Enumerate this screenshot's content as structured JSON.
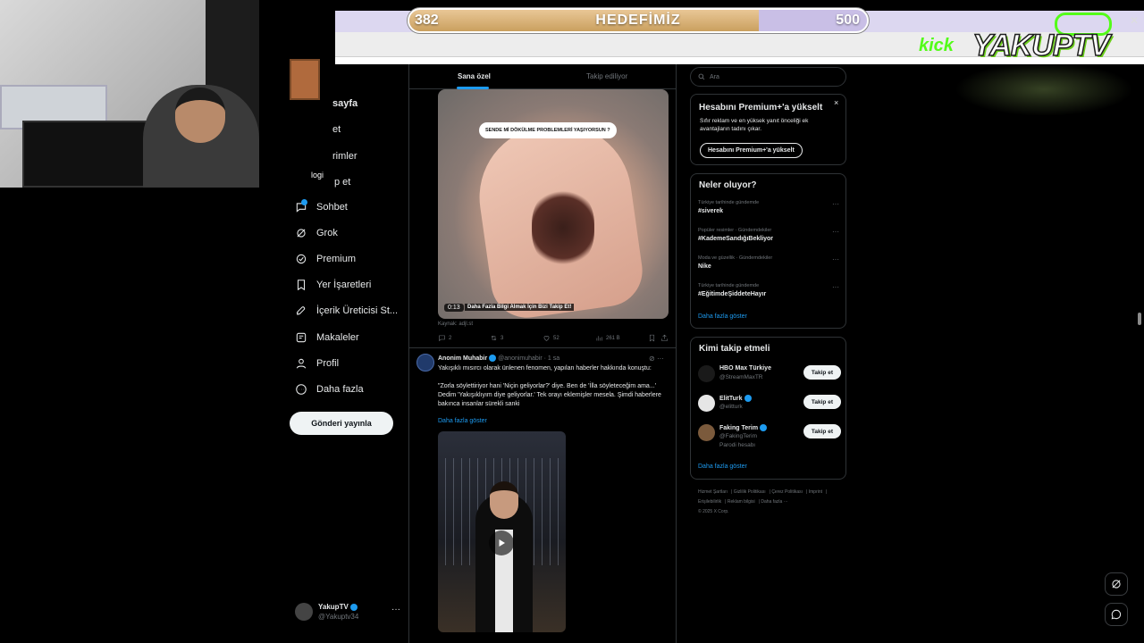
{
  "overlay": {
    "goal": {
      "current": "382",
      "label": "HEDEFİMİZ",
      "target": "500",
      "progress": 0.764
    },
    "brand": {
      "platform": "kick",
      "channel": "YAKUPTV"
    },
    "close": "✕",
    "webcam_caption": "logi"
  },
  "nav": {
    "items": [
      {
        "label": "sayfa",
        "icon": "home-icon"
      },
      {
        "label": "et",
        "icon": "explore-icon"
      },
      {
        "label": "rimler",
        "icon": "notifications-icon"
      },
      {
        "label": "p et",
        "icon": "follow-icon"
      },
      {
        "label": "Sohbet",
        "icon": "chat-icon"
      },
      {
        "label": "Grok",
        "icon": "grok-icon"
      },
      {
        "label": "Premium",
        "icon": "premium-icon"
      },
      {
        "label": "Yer İşaretleri",
        "icon": "bookmark-icon"
      },
      {
        "label": "İçerik Üreticisi St...",
        "icon": "rocket-icon"
      },
      {
        "label": "Makaleler",
        "icon": "article-icon"
      },
      {
        "label": "Profil",
        "icon": "profile-icon"
      },
      {
        "label": "Daha fazla",
        "icon": "more-circle-icon"
      }
    ],
    "post_button": "Gönderi yayınla",
    "account": {
      "name": "YakupTV",
      "handle": "@Yakuptv34",
      "more": "···"
    }
  },
  "timeline": {
    "tabs": [
      {
        "label": "Sana özel",
        "active": true
      },
      {
        "label": "Takip ediliyor",
        "active": false
      }
    ],
    "post1": {
      "caption": "SENDE Mİ DÖKÜLME PROBLEMLERİ YAŞIYORSUN ?",
      "video_time": "0:13",
      "subtitle": "Daha Fazla Bilgi Almak İçin Bizi Takip Et!",
      "source": "Kaynak: adjl.st",
      "stats": {
        "replies": "2",
        "reposts": "3",
        "likes": "52",
        "views": "261 B"
      }
    },
    "post2": {
      "name": "Anonim Muhabir",
      "handle": "@anonimuhabir",
      "time": "· 1 sa",
      "more": "···",
      "body": "Yakışıklı mısırcı olarak ünlenen fenomen, yapılan haberler hakkında konuştu:\n\n\"Zorla söylettiriyor hani 'Niçin geliyorlar?' diye. Ben de 'İlla söyleteceğim ama...' Dedim 'Yakışıklıyım diye geliyorlar.' Tek orayı eklemişler mesela. Şimdi haberlere bakınca insanlar sürekli sanki",
      "show_more": "Daha fazla göster"
    }
  },
  "sidebar": {
    "search_placeholder": "Ara",
    "premium": {
      "title": "Hesabını Premium+'a yükselt",
      "desc": "Sıfır reklam ve en yüksek yanıt önceliği ek avantajların tadını çıkar.",
      "button": "Hesabını Premium+'a yükselt",
      "close": "×"
    },
    "trends": {
      "title": "Neler oluyor?",
      "items": [
        {
          "context": "Türkiye tarihinde gündemde",
          "tag": "#siverek"
        },
        {
          "context": "Popüler resimler · Gündemdekiler",
          "tag": "#KademeSandığıBekliyor"
        },
        {
          "context": "Moda ve güzellik · Gündemdekiler",
          "tag": "Nike"
        },
        {
          "context": "Türkiye tarihinde gündemde",
          "tag": "#EğitimdeŞiddeteHayır"
        }
      ],
      "show_more": "Daha fazla göster"
    },
    "who_to_follow": {
      "title": "Kimi takip etmeli",
      "items": [
        {
          "name": "HBO Max Türkiye",
          "handle": "@StreamMaxTR",
          "extra": "",
          "button": "Takip et",
          "avatar_color": "#1a1a1a"
        },
        {
          "name": "ElitTurk",
          "handle": "@elitturk",
          "extra": "",
          "button": "Takip et",
          "avatar_color": "#e6e6e6"
        },
        {
          "name": "Faking Terim",
          "handle": "@FakingTerim",
          "extra": "Parodi hesabı",
          "button": "Takip et",
          "avatar_color": "#7b5a3c"
        }
      ],
      "show_more": "Daha fazla göster"
    },
    "footer": {
      "links": [
        "Hizmet Şartları",
        "Gizlilik Politikası",
        "Çerez Politikası",
        "Imprint",
        "Erişilebilirlik",
        "Reklam bilgisi",
        "Daha fazla ···"
      ],
      "copyright": "© 2025 X Corp."
    }
  },
  "colors": {
    "accent": "#1d9bf0",
    "background": "#000000",
    "text": "#e7e9ea",
    "muted": "#71767b",
    "kick": "#53fc18"
  }
}
